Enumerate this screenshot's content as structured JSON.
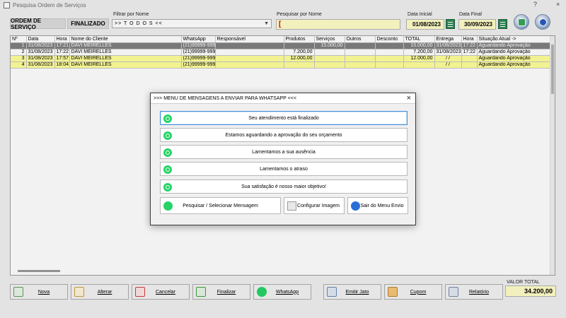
{
  "window": {
    "title": "Pesquisa Ordem de Serviços",
    "help_symbol": "?",
    "close_symbol": "×"
  },
  "header": {
    "os_label": "ORDEM DE SERVIÇO",
    "status_label": "FINALIZADO",
    "filter_label": "Filtrar por Nome",
    "filter_value": ">>  T O D O S  <<",
    "search_label": "Pesquisar por Nome",
    "search_value": "[",
    "start_date_label": "Data Inicial",
    "start_date": "01/08/2023",
    "end_date_label": "Data Final",
    "end_date": "30/09/2023"
  },
  "grid": {
    "columns": [
      "Nº",
      "Data",
      "Hora",
      "Nome do Cliente",
      "WhatsApp",
      "Responsável",
      "Produtos",
      "Serviços",
      "Outros",
      "Desconto",
      "TOTAL",
      "Entrega",
      "Hora",
      "Situação Atual ->"
    ],
    "rows": [
      {
        "no": "1",
        "data": "31/08/2023",
        "hora": "17:21",
        "cliente": "DAVI MEIRELLES",
        "whatsapp": "(21)99999-9999",
        "responsavel": "",
        "produtos": "",
        "servicos": "15.000,00",
        "outros": "",
        "desconto": "",
        "total": "15.000,00",
        "entrega": "31/08/2023",
        "hora_entrega": "17:22",
        "situacao": "Aguardando Aprovação",
        "style": "selected"
      },
      {
        "no": "2",
        "data": "31/08/2023",
        "hora": "17:22",
        "cliente": "DAVI MEIRELLES",
        "whatsapp": "(21)99999-9999",
        "responsavel": "",
        "produtos": "7.200,00",
        "servicos": "",
        "outros": "",
        "desconto": "",
        "total": "7.200,00",
        "entrega": "31/08/2023",
        "hora_entrega": "17:22",
        "situacao": "Aguardando Aprovação",
        "style": "white"
      },
      {
        "no": "3",
        "data": "31/08/2023",
        "hora": "17:57",
        "cliente": "DAVI MEIRELLES",
        "whatsapp": "(21)99999-9999",
        "responsavel": "",
        "produtos": "12.000,00",
        "servicos": "",
        "outros": "",
        "desconto": "",
        "total": "12.000,00",
        "entrega": "/  /",
        "hora_entrega": "",
        "situacao": "Aguardando Aprovação",
        "style": "yellow"
      },
      {
        "no": "4",
        "data": "31/08/2023",
        "hora": "18:04",
        "cliente": "DAVI MEIRELLES",
        "whatsapp": "(21)99999-9999",
        "responsavel": "",
        "produtos": "",
        "servicos": "",
        "outros": "",
        "desconto": "",
        "total": "",
        "entrega": "/  /",
        "hora_entrega": "",
        "situacao": "Aguardando Aprovação",
        "style": "yellow"
      }
    ]
  },
  "modal": {
    "title": ">>>  MENU DE MENSAGENS A ENVIAR PARA WHATSAPP  <<<",
    "close": "×",
    "messages": [
      "Seu atendimento está finalizado",
      "Estamos aguardando a aprovação do seu orçamento",
      "Lamentamos a sua ausência",
      "Lamentamos o atraso",
      "Sua satisfação é nosso maior objetivo!"
    ],
    "search_button": "Pesquisar / Selecionar Mensagem",
    "config_button": "Configurar Imagem",
    "exit_button": "Sair do Menu Envio"
  },
  "actions": {
    "nova": "Nova",
    "alterar": "Alterar",
    "cancelar": "Cancelar",
    "finalizar": "Finalizar",
    "whatsapp": "WhatsApp",
    "emitir": "Emitir Jato",
    "cupom": "Cupom",
    "relatorio": "Relatório"
  },
  "totals": {
    "label": "VALOR TOTAL",
    "value": "34.200,00"
  },
  "colors": {
    "selected_row": "#808080",
    "highlight_row": "#ffff99",
    "input_bg": "#fffdc8",
    "whatsapp_green": "#25d366"
  },
  "icons": [
    "whatsapp-icon",
    "calendar-icon",
    "search-icon",
    "exit-icon"
  ]
}
